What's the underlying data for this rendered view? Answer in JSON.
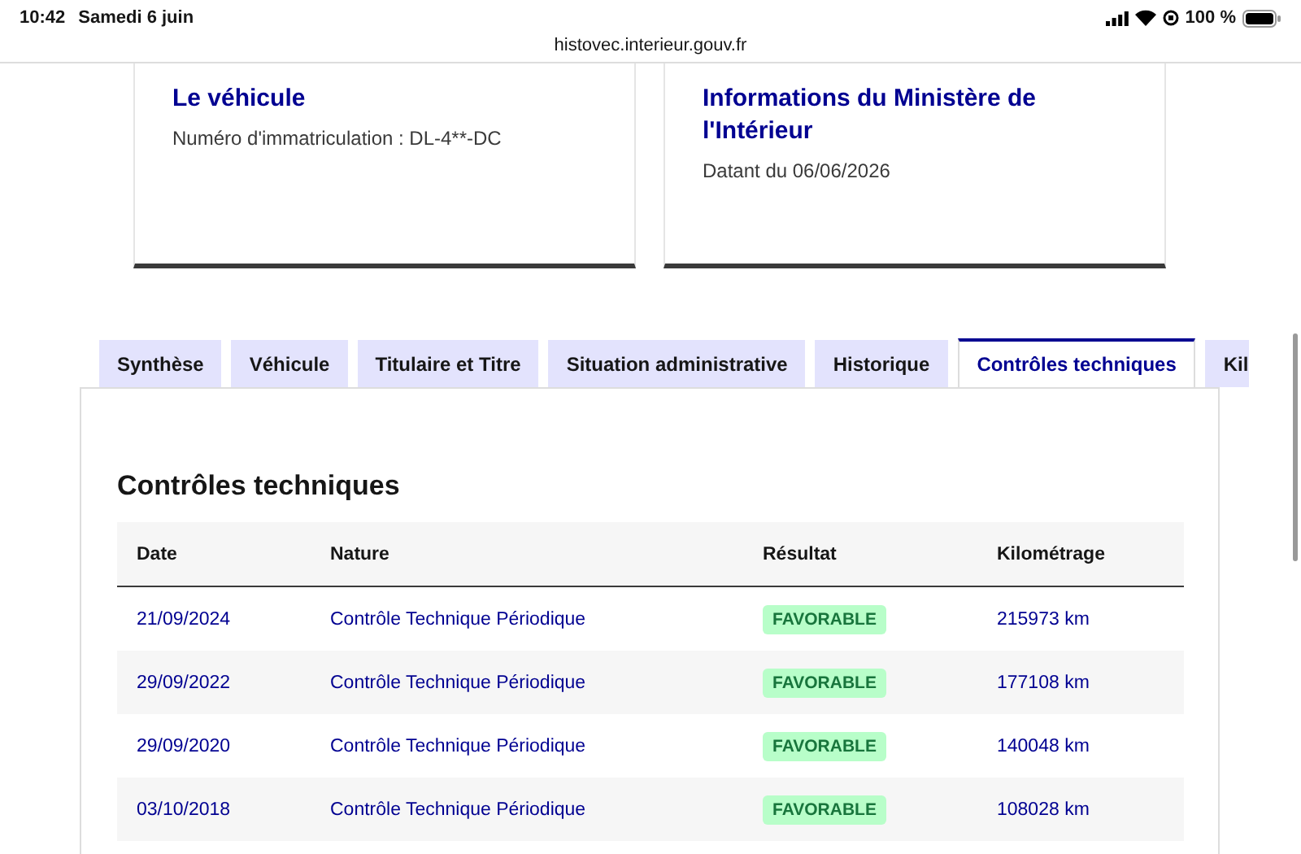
{
  "status_bar": {
    "time": "10:42",
    "date": "Samedi 6 juin",
    "battery_text": "100 %"
  },
  "url": "histovec.interieur.gouv.fr",
  "cards": [
    {
      "title": "Le véhicule",
      "text": "Numéro d'immatriculation : DL-4**-DC"
    },
    {
      "title": "Informations du Ministère de l'Intérieur",
      "text": "Datant du 06/06/2026"
    }
  ],
  "tabs": [
    {
      "label": "Synthèse",
      "selected": false
    },
    {
      "label": "Véhicule",
      "selected": false
    },
    {
      "label": "Titulaire et Titre",
      "selected": false
    },
    {
      "label": "Situation administrative",
      "selected": false
    },
    {
      "label": "Historique",
      "selected": false
    },
    {
      "label": "Contrôles techniques",
      "selected": true
    },
    {
      "label": "Kil",
      "selected": false
    }
  ],
  "section_title": "Contrôles techniques",
  "table": {
    "columns": [
      "Date",
      "Nature",
      "Résultat",
      "Kilométrage"
    ],
    "rows": [
      {
        "date": "21/09/2024",
        "nature": "Contrôle Technique Périodique",
        "result": "FAVORABLE",
        "mileage": "215973 km"
      },
      {
        "date": "29/09/2022",
        "nature": "Contrôle Technique Périodique",
        "result": "FAVORABLE",
        "mileage": "177108 km"
      },
      {
        "date": "29/09/2020",
        "nature": "Contrôle Technique Périodique",
        "result": "FAVORABLE",
        "mileage": "140048 km"
      },
      {
        "date": "03/10/2018",
        "nature": "Contrôle Technique Périodique",
        "result": "FAVORABLE",
        "mileage": "108028 km"
      }
    ]
  }
}
